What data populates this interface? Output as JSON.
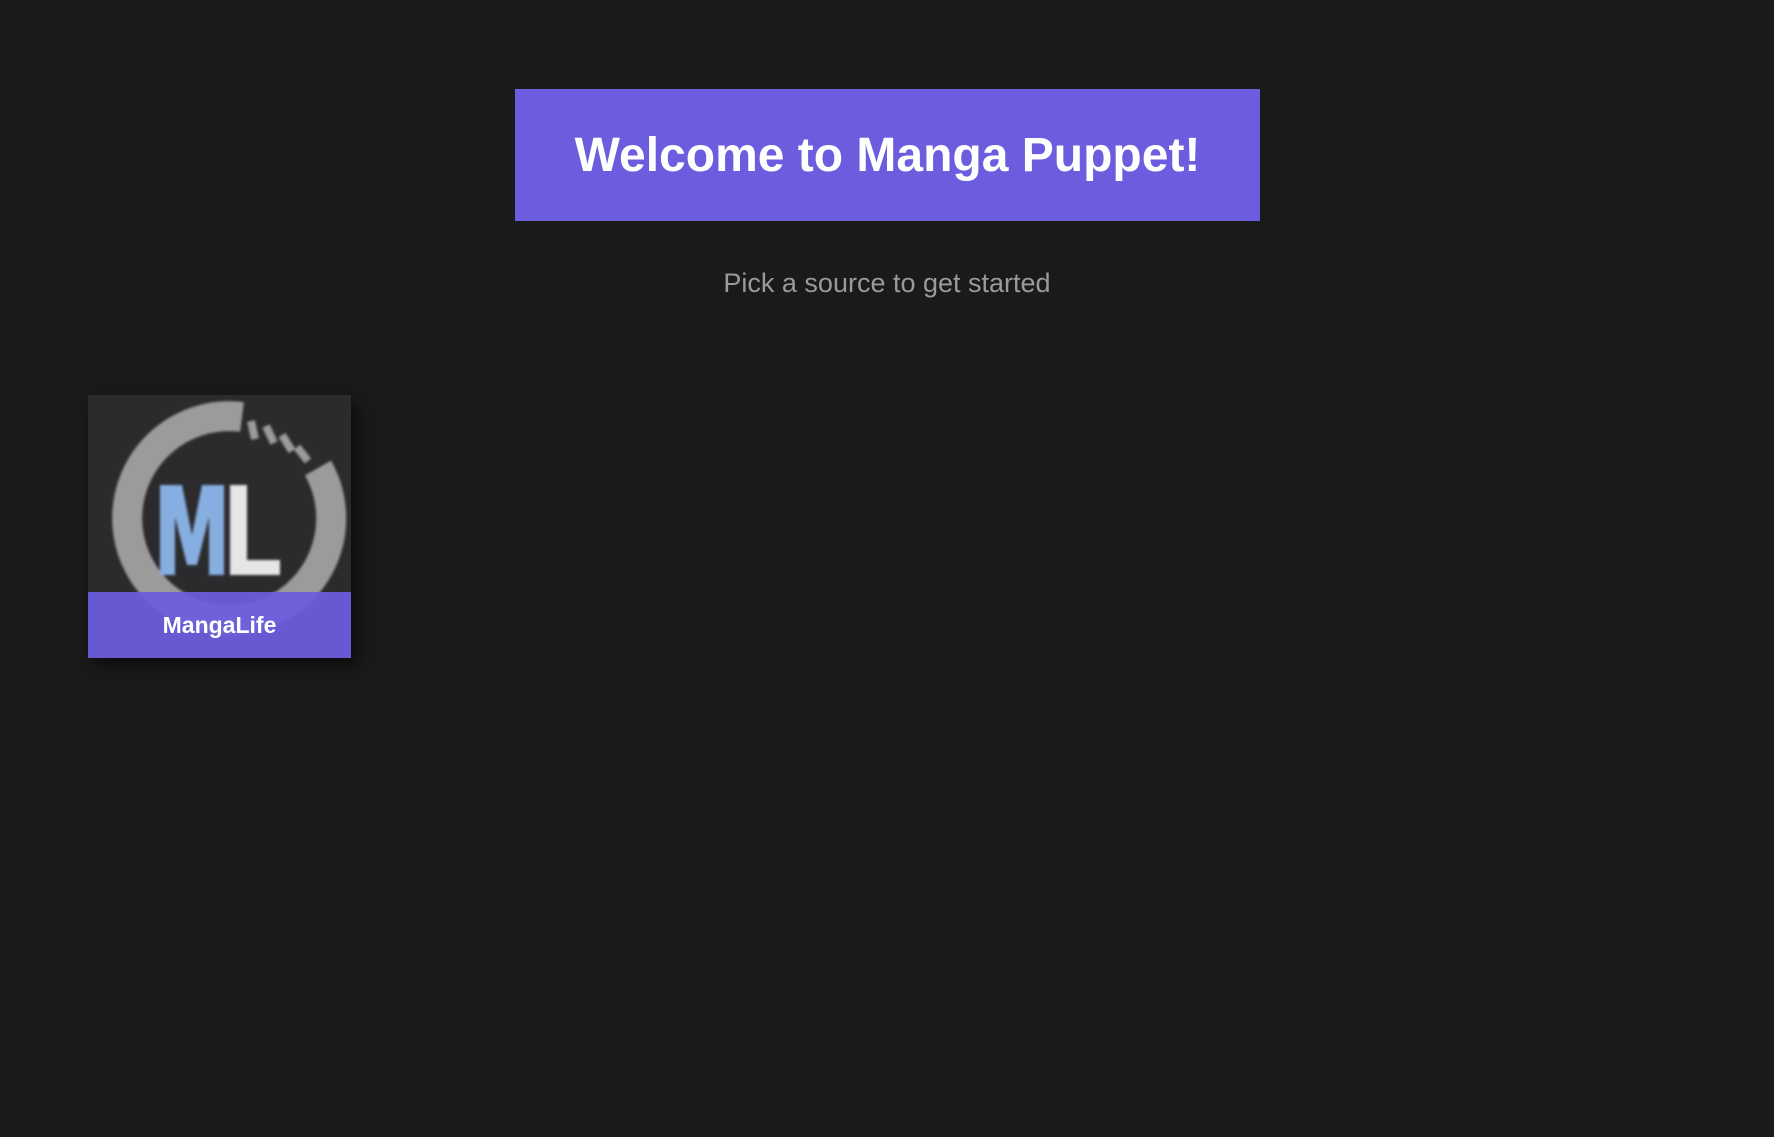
{
  "header": {
    "title": "Welcome to Manga Puppet!",
    "subtitle": "Pick a source to get started"
  },
  "sources": [
    {
      "name": "MangaLife",
      "logo_text": "ML",
      "icon": "mangalife-logo-icon"
    }
  ],
  "colors": {
    "background": "#1a1a1a",
    "accent": "#6c5ddf",
    "subtitle": "#9a9a9a",
    "card_background": "#2b2b2d",
    "logo_ring": "#9b9b9b",
    "logo_m": "#87aee0",
    "logo_l": "#e6e6e6"
  }
}
